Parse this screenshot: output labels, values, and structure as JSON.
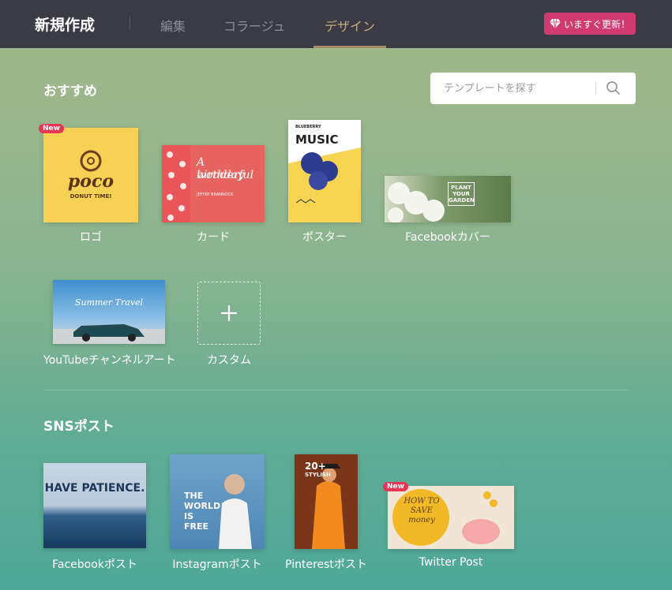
{
  "header": {
    "title": "新規作成",
    "tabs": [
      {
        "label": "編集"
      },
      {
        "label": "コラージュ"
      },
      {
        "label": "デザイン",
        "active": true
      }
    ],
    "upgrade_label": "いますぐ更新！"
  },
  "recommended": {
    "title": "おすすめ",
    "search_placeholder": "テンプレートを探す",
    "items": [
      {
        "label": "ロゴ",
        "badge": "New",
        "thumb_text": [
          "poco",
          "DONUT TIME!"
        ]
      },
      {
        "label": "カード",
        "thumb_text": [
          "A wonderful",
          "birthday",
          "JEFFRY BRANNOCK"
        ]
      },
      {
        "label": "ポスター",
        "thumb_text": [
          "BLUEBERRY",
          "MUSIC"
        ]
      },
      {
        "label": "Facebookカバー",
        "thumb_text": [
          "PLANT",
          "YOUR",
          "GARDEN"
        ]
      },
      {
        "label": "YouTubeチャンネルアート",
        "thumb_text": [
          "Summer Travel"
        ]
      },
      {
        "label": "カスタム"
      }
    ]
  },
  "sns": {
    "title": "SNSポスト",
    "items": [
      {
        "label": "Facebookポスト",
        "thumb_text": [
          "HAVE PATIENCE."
        ]
      },
      {
        "label": "Instagramポスト",
        "thumb_text": [
          "THE",
          "WORLD",
          "IS",
          "FREE"
        ]
      },
      {
        "label": "Pinterestポスト",
        "thumb_text": [
          "20+",
          "STYLISH"
        ]
      },
      {
        "label": "Twitter Post",
        "badge": "New",
        "thumb_text": [
          "HOW TO",
          "SAVE",
          "money"
        ]
      }
    ]
  },
  "colors": {
    "accent": "#c7ad78",
    "upgrade": "#d03a6f",
    "new_badge": "#e83455",
    "topbar": "#3b3b46"
  }
}
